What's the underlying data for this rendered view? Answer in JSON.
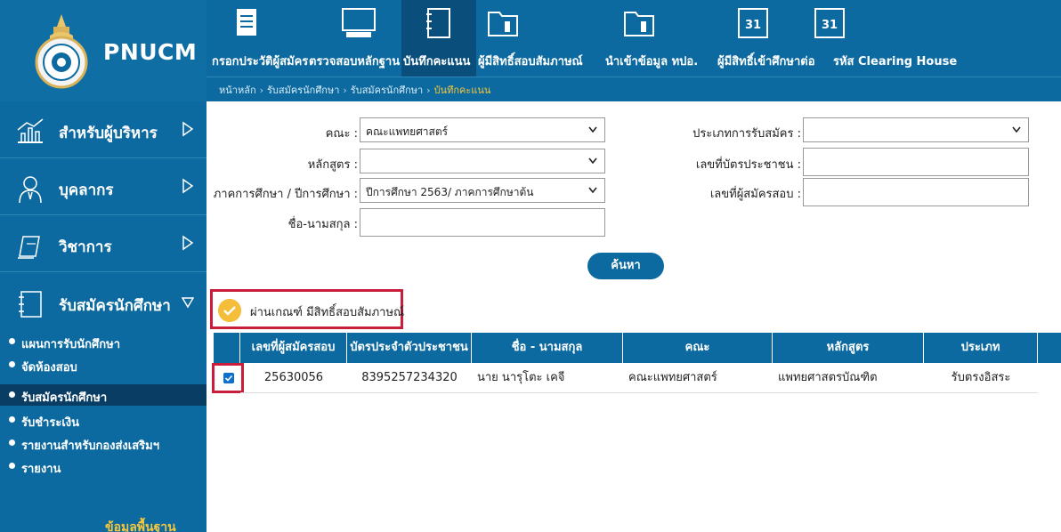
{
  "brand": {
    "logo_text": "PNUCM"
  },
  "topnav": [
    {
      "label": "กรอกประวัติผู้สมัคร",
      "icon": "document-icon"
    },
    {
      "label": "ตรวจสอบหลักฐาน",
      "icon": "computer-icon"
    },
    {
      "label": "บันทึกคะแนน",
      "icon": "notebook-icon",
      "active": true
    },
    {
      "label": "ผู้มีสิทธิ์สอบสัมภาษณ์",
      "icon": "folder-icon"
    },
    {
      "label": "นำเข้าข้อมูล ทปอ.",
      "icon": "folder-icon"
    },
    {
      "label": "ผู้มีสิทธิ์เข้าศึกษาต่อ",
      "icon": "calendar-icon"
    },
    {
      "label": "รหัส Clearing House",
      "icon": "calendar-icon"
    }
  ],
  "breadcrumb": {
    "items": [
      "หน้าหลัก",
      "รับสมัครนักศึกษา",
      "รับสมัครนักศึกษา"
    ],
    "current": "บันทึกคะแนน"
  },
  "sidebar": {
    "sections": [
      {
        "label": "สำหรับผู้บริหาร",
        "icon": "chart-icon"
      },
      {
        "label": "บุคลากร",
        "icon": "person-icon"
      },
      {
        "label": "วิชาการ",
        "icon": "book-icon"
      },
      {
        "label": "รับสมัครนักศึกษา",
        "icon": "notebook-icon",
        "expanded": true
      }
    ],
    "subitems": [
      {
        "label": "แผนการรับนักศึกษา"
      },
      {
        "label": "จัดห้องสอบ"
      },
      {
        "label": "รับสมัครนักศึกษา",
        "active": true
      },
      {
        "label": "รับชำระเงิน"
      },
      {
        "label": "รายงานสำหรับกองส่งเสริมฯ"
      },
      {
        "label": "รายงาน"
      }
    ],
    "footer_link": "ข้อมูลพื้นฐาน"
  },
  "filters": {
    "faculty_label": "คณะ :",
    "faculty_value": "คณะแพทยศาสตร์",
    "curriculum_label": "หลักสูตร :",
    "curriculum_value": "",
    "semester_label": "ภาคการศึกษา / ปีการศึกษา :",
    "semester_value": "ปีการศึกษา 2563/ ภาคการศึกษาต้น",
    "name_label": "ชื่อ-นามสกุล :",
    "name_value": "",
    "admission_type_label": "ประเภทการรับสมัคร :",
    "admission_type_value": "",
    "id_card_label": "เลขที่บัตรประชาชน :",
    "id_card_value": "",
    "applicant_no_label": "เลขที่ผู้สมัครสอบ :",
    "applicant_no_value": "",
    "search_button": "ค้นหา"
  },
  "pass_criteria": {
    "text": "ผ่านเกณฑ์ มีสิทธิ์สอบสัมภาษณ์"
  },
  "table": {
    "columns": [
      "เลขที่ผู้สมัครสอบ",
      "บัตรประจำตัวประชาชน",
      "ชื่อ - นามสกุล",
      "คณะ",
      "หลักสูตร",
      "ประเภท"
    ],
    "rows": [
      {
        "checked": true,
        "cells": [
          "25630056",
          "8395257234320",
          "นาย นารุโตะ เคจี",
          "คณะแพทยศาสตร์",
          "แพทยศาสตรบัณฑิต",
          "รับตรงอิสระ"
        ]
      }
    ]
  },
  "colors": {
    "primary": "#0c6aa0",
    "accent": "#f6c73b",
    "highlight_border": "#c81e3c",
    "check_circle": "#f4be3a"
  }
}
